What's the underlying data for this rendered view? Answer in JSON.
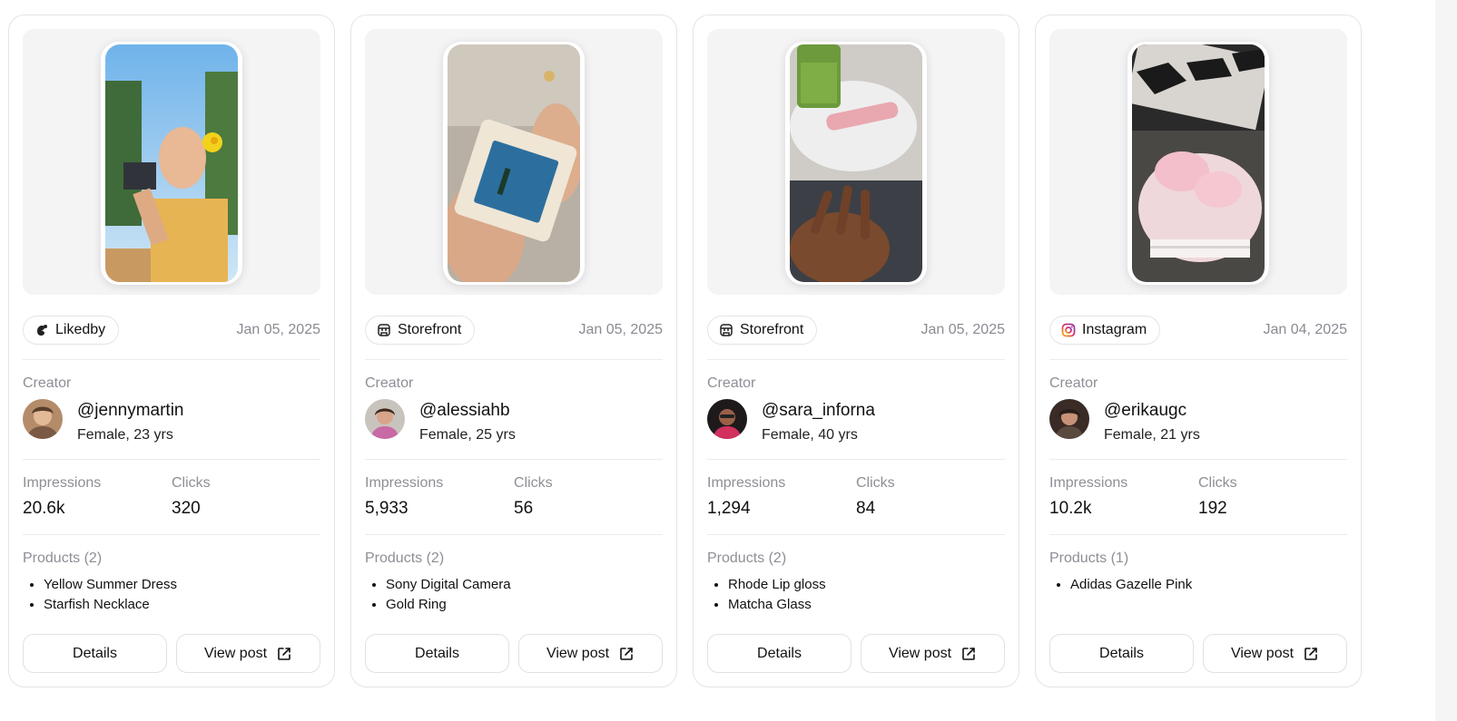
{
  "labels": {
    "creator": "Creator",
    "impressions": "Impressions",
    "clicks": "Clicks",
    "details_button": "Details",
    "view_post_button": "View post"
  },
  "cards": [
    {
      "source": "Likedby",
      "source_icon": "likedby-logo-icon",
      "date": "Jan 05, 2025",
      "handle": "@jennymartin",
      "demographic": "Female, 23 yrs",
      "impressions": "20.6k",
      "clicks": "320",
      "products_label": "Products (2)",
      "products": [
        "Yellow Summer Dress",
        "Starfish Necklace"
      ]
    },
    {
      "source": "Storefront",
      "source_icon": "storefront-icon",
      "date": "Jan 05, 2025",
      "handle": "@alessiahb",
      "demographic": "Female, 25 yrs",
      "impressions": "5,933",
      "clicks": "56",
      "products_label": "Products (2)",
      "products": [
        "Sony Digital Camera",
        "Gold Ring"
      ]
    },
    {
      "source": "Storefront",
      "source_icon": "storefront-icon",
      "date": "Jan 05, 2025",
      "handle": "@sara_inforna",
      "demographic": "Female, 40 yrs",
      "impressions": "1,294",
      "clicks": "84",
      "products_label": "Products (2)",
      "products": [
        "Rhode Lip gloss",
        "Matcha Glass"
      ]
    },
    {
      "source": "Instagram",
      "source_icon": "instagram-icon",
      "date": "Jan 04, 2025",
      "handle": "@erikaugc",
      "demographic": "Female, 21 yrs",
      "impressions": "10.2k",
      "clicks": "192",
      "products_label": "Products (1)",
      "products": [
        "Adidas Gazelle Pink"
      ]
    }
  ]
}
